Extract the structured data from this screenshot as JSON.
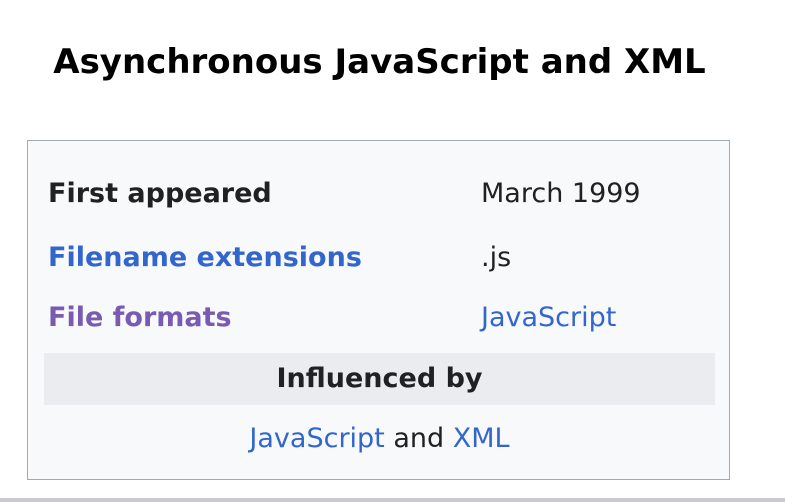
{
  "infobox": {
    "title": "Asynchronous JavaScript and XML",
    "rows": [
      {
        "label": "First appeared",
        "value": "March 1999"
      },
      {
        "label": "Filename extensions",
        "value": ".js"
      },
      {
        "label": "File formats",
        "value": "JavaScript"
      }
    ],
    "influenced_header": "Influenced by",
    "influenced": {
      "first": "JavaScript",
      "conjunction": " and ",
      "second": "XML"
    }
  },
  "colors": {
    "link": "#3366cc",
    "visited_link": "#795cb2",
    "text": "#202122",
    "box_background": "#f8f9fa",
    "box_border": "#a2a9b1",
    "header_background": "#eaecf0"
  }
}
